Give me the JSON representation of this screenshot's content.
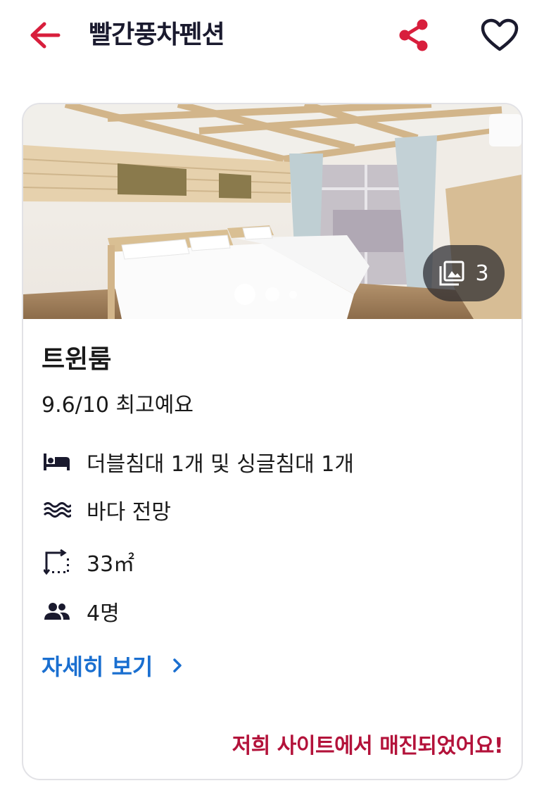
{
  "header": {
    "title": "빨간풍차펜션",
    "back_icon": "arrow-left-icon",
    "share_icon": "share-icon",
    "favorite_icon": "heart-outline-icon",
    "accent_color": "#d81e3c"
  },
  "room": {
    "photo_count": "3",
    "photo_count_icon": "photo-library-icon",
    "carousel_dots": 3,
    "carousel_active_index": 0,
    "name": "트윈룸",
    "rating": "9.6/10 최고예요",
    "features": [
      {
        "icon": "bed-icon",
        "text": "더블침대 1개 및 싱글침대 1개"
      },
      {
        "icon": "waves-icon",
        "text": "바다 전망"
      },
      {
        "icon": "area-icon",
        "text": "33㎡"
      },
      {
        "icon": "people-icon",
        "text": "4명"
      }
    ],
    "detail_link": "자세히 보기",
    "sold_out_text": "저희 사이트에서 매진되었어요!"
  },
  "colors": {
    "link": "#1a6fd0",
    "sold_out": "#b3123a",
    "title": "#1a1a2e"
  }
}
